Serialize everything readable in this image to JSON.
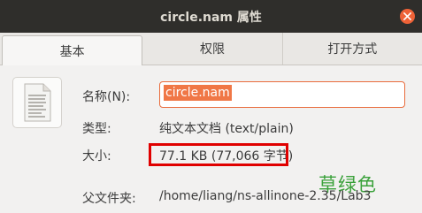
{
  "window": {
    "title": "circle.nam 属性"
  },
  "tabs": [
    {
      "label": "基本"
    },
    {
      "label": "权限"
    },
    {
      "label": "打开方式"
    }
  ],
  "basic": {
    "name_label": "名称(N):",
    "name_value": "circle.nam",
    "type_label": "类型:",
    "type_value": "纯文本文档 (text/plain)",
    "size_label": "大小:",
    "size_value": "77.1 KB (77,066 字节)",
    "parent_label": "父文件夹:",
    "parent_value": "/home/liang/ns-allinone-2.35/Lab3"
  },
  "annotation": {
    "text": "草绿色",
    "color": "#3aa13a"
  },
  "colors": {
    "titlebar": "#2f2e2b",
    "accent": "#e96c3c",
    "highlight": "#e00000"
  },
  "icons": {
    "file": "text-file-icon",
    "close": "close-icon"
  }
}
